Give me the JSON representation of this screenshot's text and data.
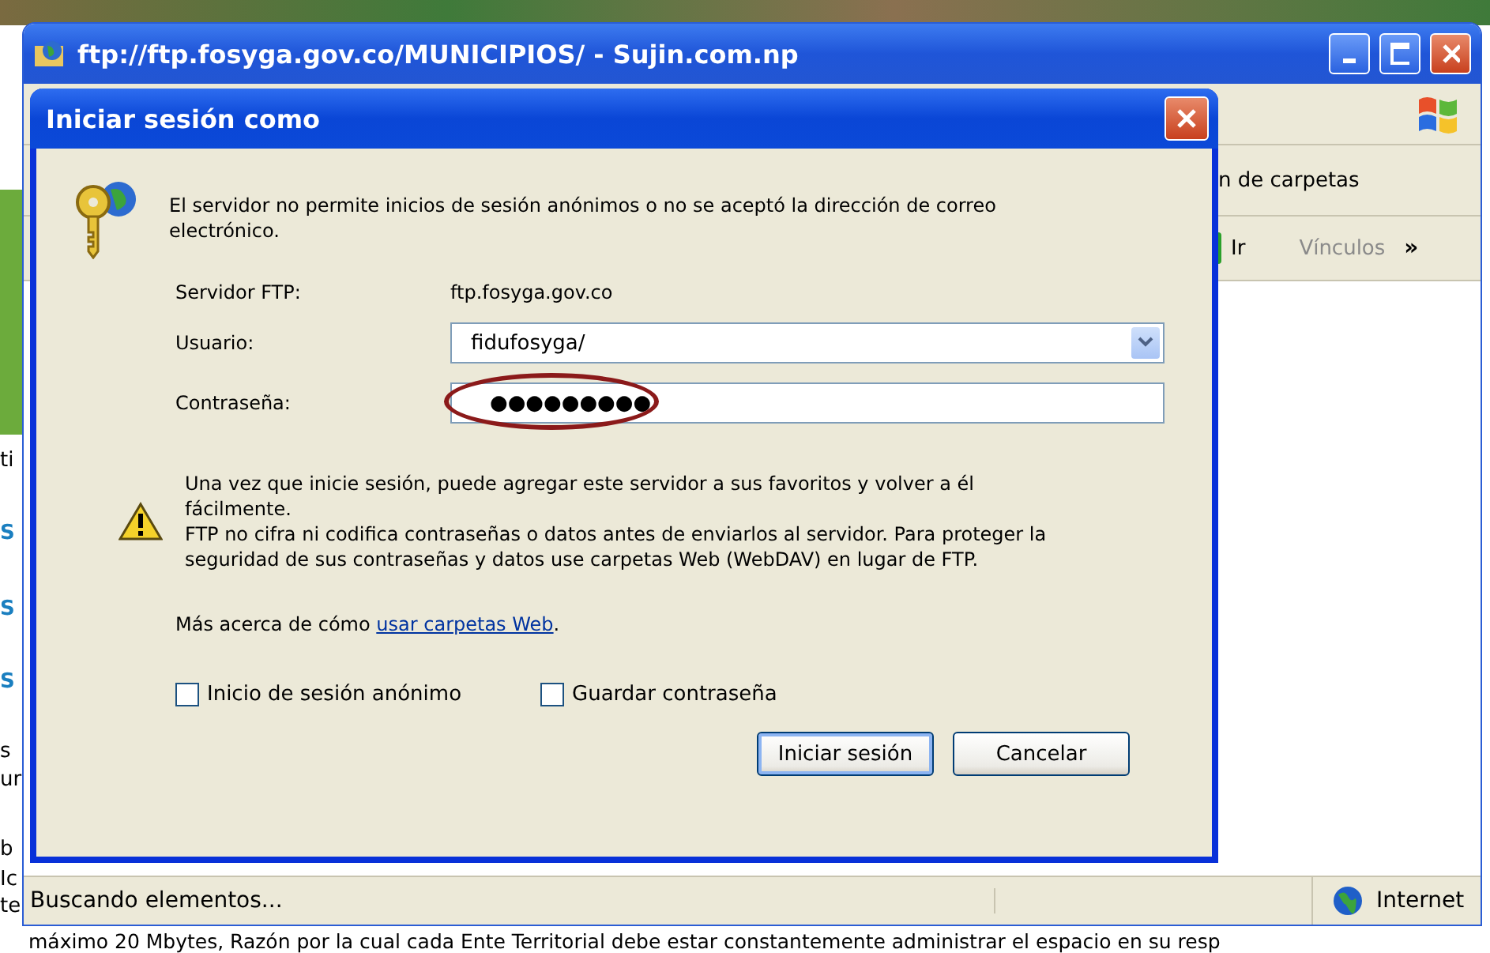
{
  "window": {
    "title": "ftp://ftp.fosyga.gov.co/MUNICIPIOS/ - Sujin.com.np"
  },
  "toolbar": {
    "folders_button": "n de carpetas",
    "go_button": "Ir",
    "links_label": "Vínculos",
    "chevron": "»"
  },
  "dialog": {
    "title": "Iniciar sesión como",
    "message": "El servidor no permite inicios de sesión anónimos o no se aceptó la  dirección de correo electrónico.",
    "server_label": "Servidor FTP:",
    "server": "ftp.fosyga.gov.co",
    "user_label": "Usuario:",
    "user": "fidufosyga/",
    "password_label": "Contraseña:",
    "password_mask": "●●●●●●●●●",
    "password_circled": true,
    "info": "Una vez que inicie sesión, puede agregar este servidor a sus favoritos y volver a él fácilmente.",
    "warning": "FTP no cifra ni codifica contraseñas o datos antes de enviarlos al servidor.  Para proteger la seguridad de sus contraseñas y datos use carpetas Web (WebDAV) en lugar de FTP.",
    "more_text": "Más acerca de cómo",
    "more_link": "usar carpetas Web",
    "more_suffix": ".",
    "checkboxes": [
      {
        "label": "Inicio de sesión anónimo",
        "checked": false
      },
      {
        "label": "Guardar contraseña",
        "checked": false
      }
    ],
    "buttons": [
      {
        "label": "Iniciar sesión",
        "default": true
      },
      {
        "label": "Cancelar",
        "default": false
      }
    ]
  },
  "status_bar": {
    "status": "Buscando elementos...",
    "zone": "Internet"
  },
  "document": {
    "margin_fragments": [
      {
        "text": "ti",
        "kind": "plain"
      },
      {
        "text": "S",
        "kind": "link"
      },
      {
        "text": "S",
        "kind": "link"
      },
      {
        "text": "S",
        "kind": "link"
      },
      {
        "text": "s",
        "kind": "plain"
      },
      {
        "text": "ur",
        "kind": "plain"
      },
      {
        "text": "b",
        "kind": "plain"
      },
      {
        "text": "Ic",
        "kind": "plain"
      },
      {
        "text": "te",
        "kind": "plain"
      }
    ],
    "footer_line": "máximo 20 Mbytes, Razón por la cual cada Ente Territorial debe estar constantemente administrar el espacio en su resp"
  }
}
